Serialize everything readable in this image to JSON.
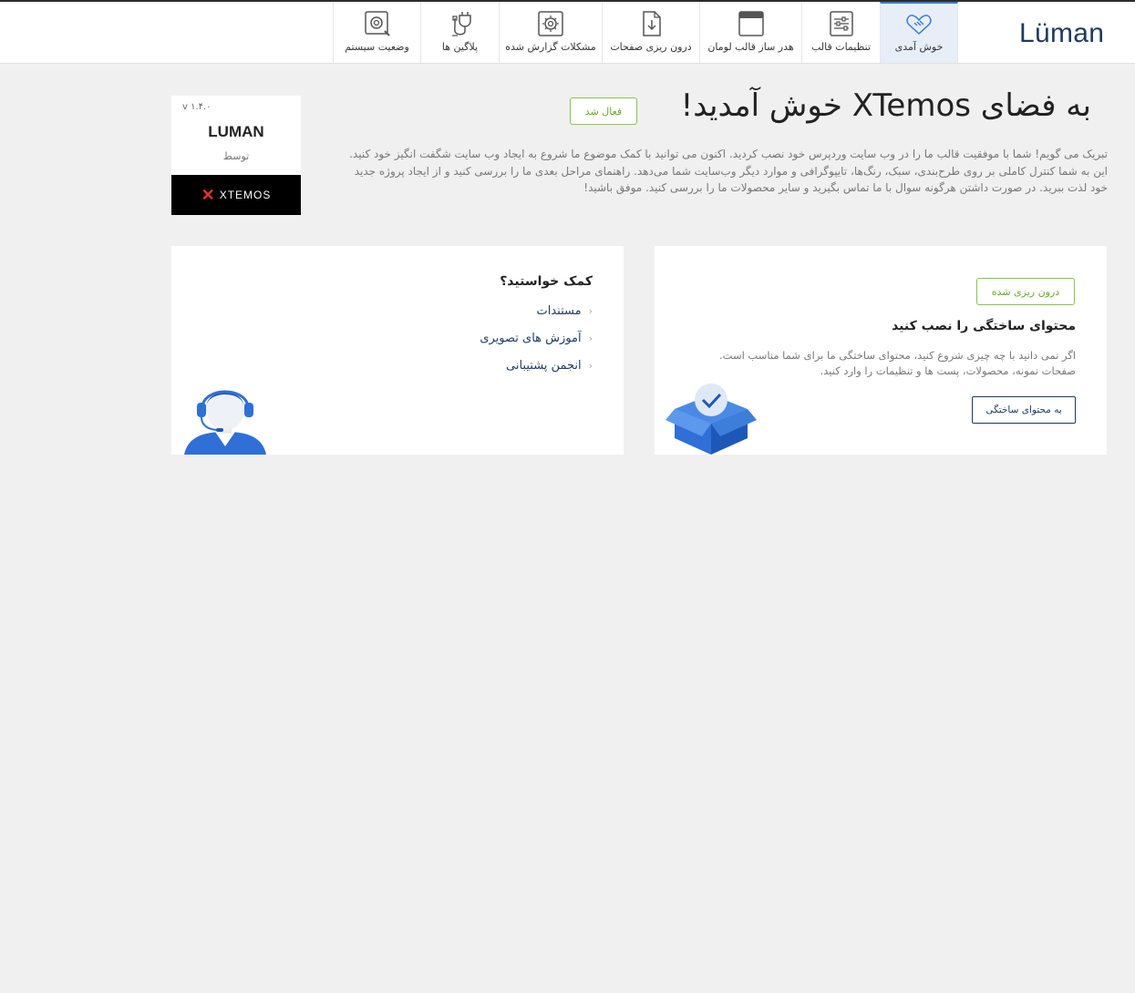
{
  "header": {
    "logo": "Lüman",
    "nav": [
      {
        "label": "خوش آمدی",
        "icon": "handshake-icon",
        "active": true
      },
      {
        "label": "تنظیمات قالب",
        "icon": "settings-sliders-icon",
        "active": false
      },
      {
        "label": "هدر ساز قالب لومان",
        "icon": "header-builder-icon",
        "active": false
      },
      {
        "label": "درون ریزی صفحات",
        "icon": "import-document-icon",
        "active": false
      },
      {
        "label": "مشکلات گزارش شده",
        "icon": "gear-report-icon",
        "active": false
      },
      {
        "label": "پلاگین ها",
        "icon": "plugin-plug-icon",
        "active": false
      },
      {
        "label": "وضعیت سیستم",
        "icon": "system-status-icon",
        "active": false
      }
    ]
  },
  "welcome": {
    "title": "به فضای XTemos خوش آمدید!",
    "activated_badge": "فعال شد",
    "intro": "تبریک می گویم! شما با موفقیت قالب ما را در وب سایت وردپرس خود نصب کردید. اکنون می توانید با کمک موضوع ما شروع به ایجاد وب سایت شگفت انگیز خود کنید. این به شما کنترل کاملی بر روی طرح‌بندی، سبک، رنگ‌ها، تایپوگرافی و موارد دیگر وب‌سایت شما می‌دهد. راهنمای مراحل بعدی ما را بررسی کنید و از ایجاد پروژه جدید خود لذت ببرید. در صورت داشتن هرگونه سوال با ما تماس بگیرید و سایر محصولات ما را بررسی کنید. موفق باشید!"
  },
  "version_box": {
    "version": "v ۱.۴.۰",
    "theme_name": "LUMAN",
    "by_label": "توسط",
    "brand": "XTEMOS"
  },
  "demo_card": {
    "badge": "درون ریزی شده",
    "title": "محتوای ساختگی را نصب کنید",
    "description": "اگر نمی دانید با چه چیزی شروع کنید، محتوای ساختگی ما برای شما مناسب است. صفحات نمونه، محصولات، پست ها و تنظیمات را وارد کنید.",
    "button": "به محتوای ساختگی",
    "illustration": "box-check-icon"
  },
  "help_card": {
    "title": "کمک خواستید؟",
    "links": [
      "مستندات",
      "آموزش های تصویری",
      "انجمن پشتیبانی"
    ],
    "illustration": "support-agent-icon"
  },
  "colors": {
    "accent": "#3a7bd5",
    "brand_dark": "#1e3a5f",
    "success": "#8bc34a",
    "page_bg": "#f0f0f0"
  }
}
